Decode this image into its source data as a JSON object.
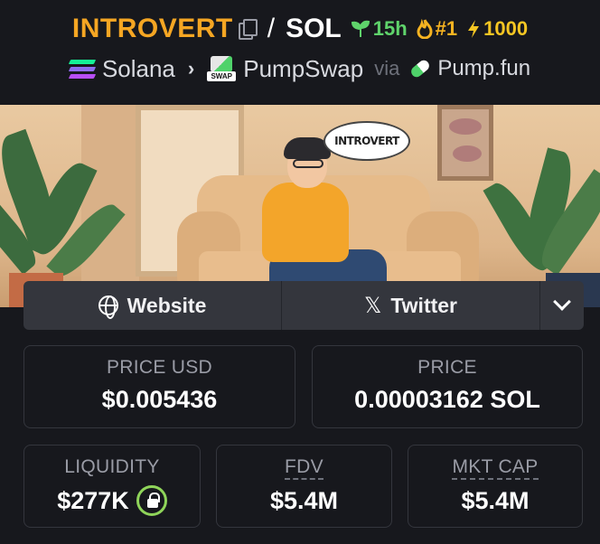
{
  "header": {
    "symbol": "INTROVERT",
    "separator": "/",
    "quote": "SOL",
    "age": "15h",
    "rank": "#1",
    "boost": "1000",
    "chain": "Solana",
    "dex": "PumpSwap",
    "via": "via",
    "launchpad": "Pump.fun",
    "colors": {
      "symbol": "#f5a623",
      "age": "#5fd36b",
      "rank": "#f6b321",
      "boost": "#f6c623"
    }
  },
  "banner": {
    "bubble_text": "INTROVERT"
  },
  "links": {
    "website": "Website",
    "twitter": "Twitter",
    "x_glyph": "𝕏"
  },
  "stats": {
    "price_usd": {
      "label": "PRICE USD",
      "value": "$0.005436"
    },
    "price": {
      "label": "PRICE",
      "value": "0.00003162 SOL"
    },
    "liquidity": {
      "label": "LIQUIDITY",
      "value": "$277K"
    },
    "fdv": {
      "label": "FDV",
      "value": "$5.4M"
    },
    "mkt_cap": {
      "label": "MKT CAP",
      "value": "$5.4M"
    }
  }
}
